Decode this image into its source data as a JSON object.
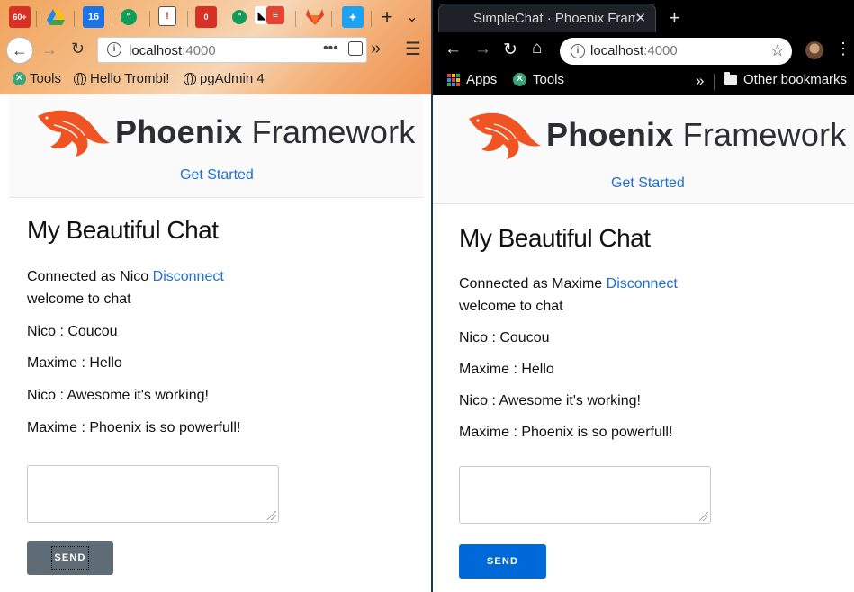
{
  "firefox": {
    "tab_badges": {
      "gmail_count": "60+",
      "calendar_day": "16",
      "gmail2_count": "0"
    },
    "url_host": "localhost",
    "url_port": ":4000",
    "bookmarks": [
      "Tools",
      "Hello Trombi!",
      "pgAdmin 4"
    ],
    "colors": {
      "send_bg": "#5f6b75"
    }
  },
  "chrome": {
    "tab_title": "SimpleChat · Phoenix Framework",
    "url_host": "localhost",
    "url_port": ":4000",
    "bookmarks": {
      "apps": "Apps",
      "tools": "Tools",
      "more": "»",
      "other": "Other bookmarks"
    },
    "colors": {
      "send_bg": "#0069d9"
    }
  },
  "site": {
    "brand_bold": "Phoenix",
    "brand_light": "Framework",
    "get_started": "Get Started",
    "title": "My Beautiful Chat",
    "disconnect": "Disconnect",
    "welcome": "welcome to chat",
    "send_label": "SEND",
    "brand_color": "#f05423",
    "link_color": "#1f6fd4"
  },
  "sessions": {
    "left": {
      "connected": "Connected as Nico"
    },
    "right": {
      "connected": "Connected as Maxime"
    }
  },
  "messages": [
    "Nico : Coucou",
    "Maxime : Hello",
    "Nico : Awesome it's working!",
    "Maxime : Phoenix is so powerfull!"
  ]
}
